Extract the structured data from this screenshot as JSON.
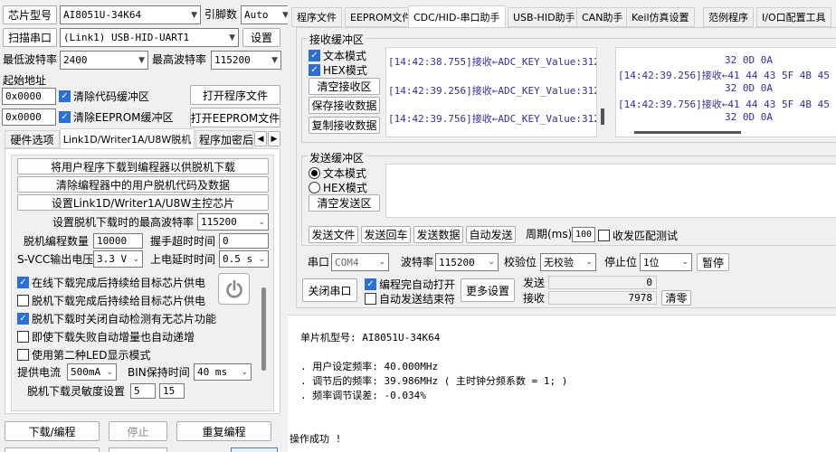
{
  "left": {
    "chip_label": "芯片型号",
    "chip_value": "AI8051U-34K64",
    "pin_label": "引脚数",
    "pin_value": "Auto",
    "scan_button": "扫描串口",
    "port_value": "(Link1) USB-HID-UART1",
    "settings_button": "设置",
    "min_baud_label": "最低波特率",
    "min_baud_value": "2400",
    "max_baud_label": "最高波特率",
    "max_baud_value": "115200",
    "start_addr_label": "起始地址",
    "addr1": "0x0000",
    "clear_code_label": "清除代码缓冲区",
    "open_prog_button": "打开程序文件",
    "addr2": "0x0000",
    "clear_eeprom_label": "清除EEPROM缓冲区",
    "open_eeprom_button": "打开EEPROM文件"
  },
  "lower_tabs": [
    "硬件选项",
    "Link1D/Writer1A/U8W脱机",
    "程序加密后"
  ],
  "offline": {
    "btn1": "将用户程序下载到编程器以供脱机下载",
    "btn2": "清除编程器中的用户脱机代码及数据",
    "btn3": "设置Link1D/Writer1A/U8W主控芯片",
    "max_baud_label": "设置脱机下载时的最高波特率",
    "max_baud_value": "115200",
    "count_label": "脱机编程数量",
    "count_value": "10000",
    "timeout_label": "握手超时时间",
    "timeout_value": "0",
    "svcc_label": "S-VCC输出电压",
    "svcc_value": "3.3 V",
    "delay_label": "上电延时时间",
    "delay_value": "0.5 s",
    "check1": "在线下载完成后持续给目标芯片供电",
    "check2": "脱机下载完成后持续给目标芯片供电",
    "check3": "脱机下载时关闭自动检测有无芯片功能",
    "check4": "即使下载失败自动增量也自动递增",
    "check5": "使用第二种LED显示模式",
    "current_label": "提供电流",
    "current_value": "500mA",
    "bin_label": "BIN保持时间",
    "bin_value": "40 ms",
    "sens_label": "脱机下载灵敏度设置",
    "sens1": "5",
    "sens2": "15"
  },
  "bottom_buttons": {
    "download": "下载/编程",
    "stop": "停止",
    "reprogram": "重复编程"
  },
  "top_tabs": [
    "程序文件",
    "EEPROM文件",
    "CDC/HID-串口助手",
    "USB-HID助手",
    "CAN助手",
    "Keil仿真设置",
    "范例程序",
    "I/O口配置工具"
  ],
  "receive": {
    "group_label": "接收缓冲区",
    "text_mode": "文本模式",
    "hex_mode": "HEX模式",
    "clear_button": "清空接收区",
    "save_button": "保存接收数据",
    "copy_button": "复制接收数据",
    "text_lines": [
      "[14:42:38.755]接收←ADC_KEY_Value:312",
      "[14:42:39.256]接收←ADC_KEY_Value:312",
      "[14:42:39.756]接收←ADC_KEY_Value:312"
    ],
    "hex_lines": [
      "32 0D 0A",
      "[14:42:39.256]接收←41 44 43 5F 4B 45 !",
      "32 0D 0A",
      "[14:42:39.756]接收←41 44 43 5F 4B 45 !",
      "32 0D 0A"
    ]
  },
  "send": {
    "group_label": "发送缓冲区",
    "text_mode": "文本模式",
    "hex_mode": "HEX模式",
    "clear_button": "清空发送区",
    "send_file": "发送文件",
    "send_enter": "发送回车",
    "send_data": "发送数据",
    "auto_send": "自动发送",
    "period_label": "周期(ms)",
    "period_value": "100",
    "match_label": "收发匹配测试"
  },
  "serial": {
    "port_label": "串口",
    "port_value": "COM4",
    "baud_label": "波特率",
    "baud_value": "115200",
    "parity_label": "校验位",
    "parity_value": "无校验",
    "stop_label": "停止位",
    "stop_value": "1位",
    "pause_button": "暂停",
    "close_button": "关闭串口",
    "auto_open": "编程完自动打开",
    "auto_close": "自动发送结束符",
    "more_button": "更多设置",
    "send_label": "发送",
    "send_count": "0",
    "recv_label": "接收",
    "recv_count": "7978",
    "clear_button": "清零"
  },
  "log": {
    "line1": "单片机型号: AI8051U-34K64",
    "line2": ". 用户设定频率: 40.000MHz",
    "line3": ". 调节后的频率: 39.986MHz ( 主时钟分频系数 = 1; )",
    "line4": ". 频率调节误差: -0.034%",
    "line5": "操作成功 !"
  }
}
